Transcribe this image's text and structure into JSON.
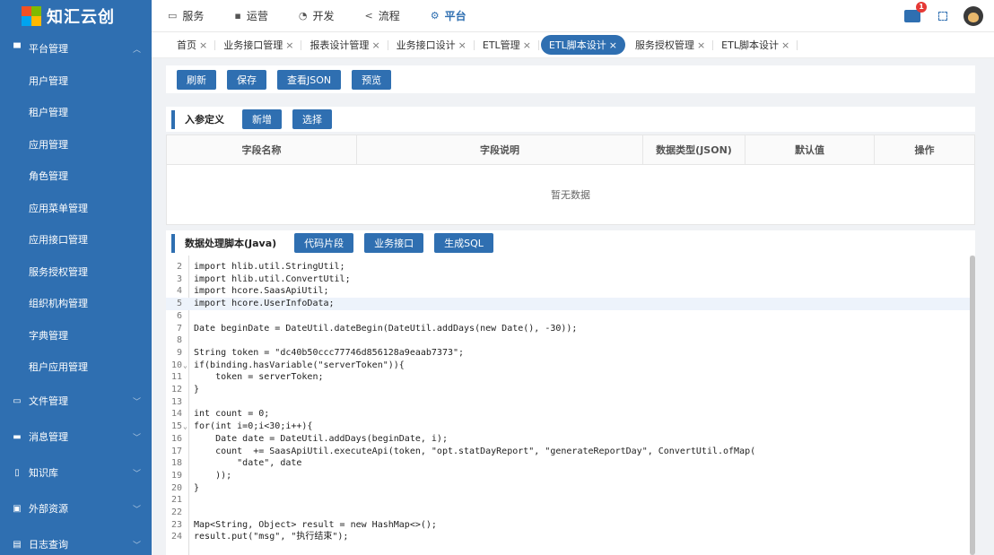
{
  "app": {
    "title": "知汇云创"
  },
  "sidebar": {
    "groups": [
      {
        "label": "平台管理",
        "icon": "monitor-icon",
        "expanded": true
      },
      {
        "label": "文件管理",
        "icon": "folder-icon",
        "expanded": false
      },
      {
        "label": "消息管理",
        "icon": "message-icon",
        "expanded": false
      },
      {
        "label": "知识库",
        "icon": "book-icon",
        "expanded": false
      },
      {
        "label": "外部资源",
        "icon": "image-icon",
        "expanded": false
      },
      {
        "label": "日志查询",
        "icon": "log-icon",
        "expanded": false
      }
    ],
    "platform_items": [
      {
        "label": "用户管理"
      },
      {
        "label": "租户管理"
      },
      {
        "label": "应用管理"
      },
      {
        "label": "角色管理"
      },
      {
        "label": "应用菜单管理"
      },
      {
        "label": "应用接口管理"
      },
      {
        "label": "服务授权管理"
      },
      {
        "label": "组织机构管理"
      },
      {
        "label": "字典管理"
      },
      {
        "label": "租户应用管理"
      }
    ]
  },
  "topnav": {
    "items": [
      {
        "label": "服务",
        "icon": "service-icon",
        "active": false
      },
      {
        "label": "运营",
        "icon": "operation-icon",
        "active": false
      },
      {
        "label": "开发",
        "icon": "develop-icon",
        "active": false
      },
      {
        "label": "流程",
        "icon": "share-icon",
        "active": false
      },
      {
        "label": "平台",
        "icon": "gear-icon",
        "active": true
      }
    ],
    "notification_count": "1"
  },
  "tabs": [
    {
      "label": "首页",
      "active": false
    },
    {
      "label": "业务接口管理",
      "active": false
    },
    {
      "label": "报表设计管理",
      "active": false
    },
    {
      "label": "业务接口设计",
      "active": false
    },
    {
      "label": "ETL管理",
      "active": false
    },
    {
      "label": "ETL脚本设计",
      "active": true
    },
    {
      "label": "服务授权管理",
      "active": false
    },
    {
      "label": "ETL脚本设计",
      "active": false
    }
  ],
  "tab_close_glyph": "×",
  "toolbar": {
    "refresh": "刷新",
    "save": "保存",
    "view_json": "查看JSON",
    "preview": "预览"
  },
  "params_section": {
    "title": "入参定义",
    "add": "新增",
    "select": "选择",
    "columns": [
      "字段名称",
      "字段说明",
      "数据类型(JSON)",
      "默认值",
      "操作"
    ],
    "empty_text": "暂无数据"
  },
  "script_section": {
    "title": "数据处理脚本(Java)",
    "snippet": "代码片段",
    "business_api": "业务接口",
    "gen_sql": "生成SQL"
  },
  "editor": {
    "lines": [
      {
        "n": "2",
        "text": "import hlib.util.StringUtil;"
      },
      {
        "n": "3",
        "text": "import hlib.util.ConvertUtil;"
      },
      {
        "n": "4",
        "text": "import hcore.SaasApiUtil;"
      },
      {
        "n": "5",
        "text": "import hcore.UserInfoData;",
        "active": true
      },
      {
        "n": "6",
        "text": ""
      },
      {
        "n": "7",
        "text": "Date beginDate = DateUtil.dateBegin(DateUtil.addDays(new Date(), -30));"
      },
      {
        "n": "8",
        "text": ""
      },
      {
        "n": "9",
        "text": "String token = \"dc40b50ccc77746d856128a9eaab7373\";"
      },
      {
        "n": "10",
        "text": "if(binding.hasVariable(\"serverToken\")){",
        "fold": true
      },
      {
        "n": "11",
        "text": "    token = serverToken;"
      },
      {
        "n": "12",
        "text": "}"
      },
      {
        "n": "13",
        "text": ""
      },
      {
        "n": "14",
        "text": "int count = 0;"
      },
      {
        "n": "15",
        "text": "for(int i=0;i<30;i++){",
        "fold": true
      },
      {
        "n": "16",
        "text": "    Date date = DateUtil.addDays(beginDate, i);"
      },
      {
        "n": "17",
        "text": "    count  += SaasApiUtil.executeApi(token, \"opt.statDayReport\", \"generateReportDay\", ConvertUtil.ofMap("
      },
      {
        "n": "18",
        "text": "        \"date\", date"
      },
      {
        "n": "19",
        "text": "    ));"
      },
      {
        "n": "20",
        "text": "}"
      },
      {
        "n": "21",
        "text": ""
      },
      {
        "n": "22",
        "text": ""
      },
      {
        "n": "23",
        "text": "Map<String, Object> result = new HashMap<>();"
      },
      {
        "n": "24",
        "text": "result.put(\"msg\", \"执行结束\");"
      }
    ]
  },
  "colors": {
    "primary": "#2f6fb1",
    "badge": "#e53935"
  }
}
